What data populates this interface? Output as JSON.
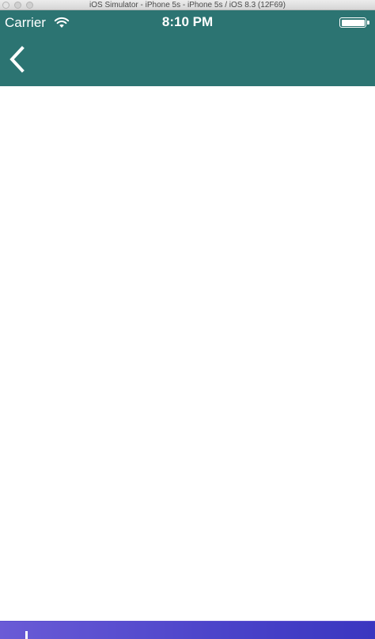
{
  "window": {
    "title": "iOS Simulator - iPhone 5s - iPhone 5s / iOS 8.3 (12F69)"
  },
  "status_bar": {
    "carrier": "Carrier",
    "time": "8:10 PM",
    "wifi_icon": "wifi-icon",
    "battery_icon": "battery-full-icon",
    "battery_level": 1.0
  },
  "nav_bar": {
    "background": "#2c7472",
    "back_icon": "chevron-left-icon"
  },
  "bottom_bar": {
    "background": "#4a43c9"
  }
}
